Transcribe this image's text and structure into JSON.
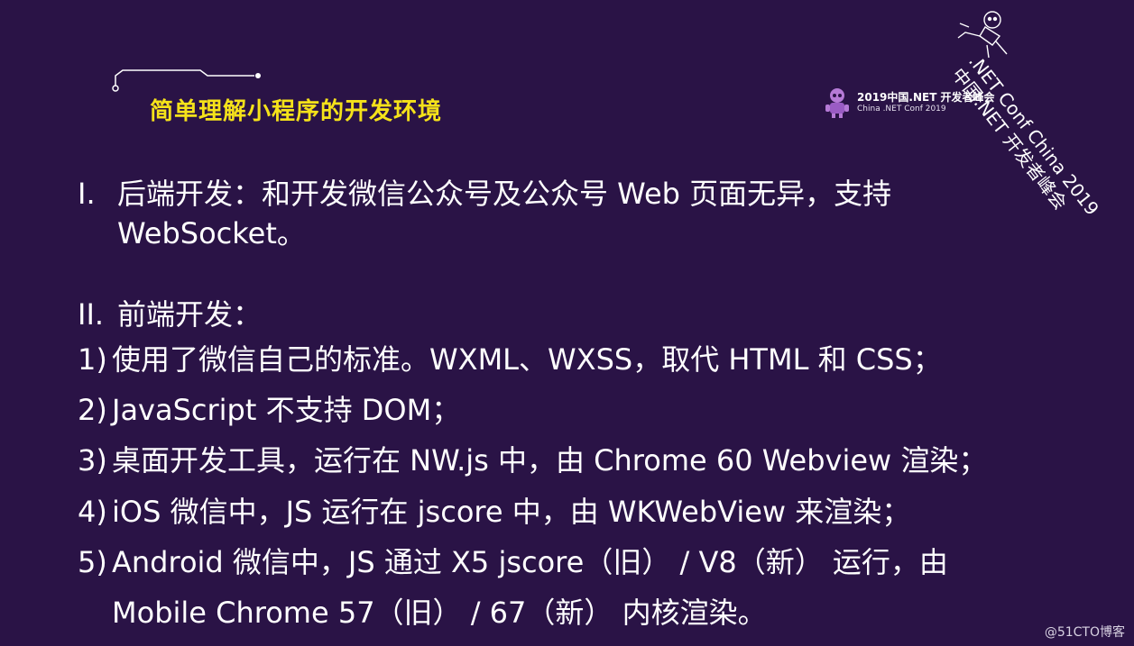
{
  "slide": {
    "heading": "简单理解小程序的开发环境",
    "logo": {
      "title": "2019中国.NET 开发者峰会",
      "subtitle": "China .NET Conf 2019"
    },
    "corner_banner": {
      "line1": ".NET Conf China 2019",
      "line2": "中国.NET 开发者峰会"
    },
    "items": [
      {
        "marker": "I.",
        "lines": [
          "后端开发：和开发微信公众号及公众号 Web 页面无异，支持",
          "WebSocket。"
        ]
      },
      {
        "marker": "II.",
        "lines": [
          "前端开发："
        ]
      }
    ],
    "sub_items": [
      {
        "marker": "1)",
        "lines": [
          "使用了微信自己的标准。WXML、WXSS，取代 HTML 和 CSS；"
        ]
      },
      {
        "marker": "2)",
        "lines": [
          "JavaScript 不支持 DOM；"
        ]
      },
      {
        "marker": "3)",
        "lines": [
          "桌面开发工具，运行在 NW.js 中，由 Chrome 60 Webview 渲染；"
        ]
      },
      {
        "marker": "4)",
        "lines": [
          "iOS 微信中，JS 运行在 jscore 中，由 WKWebView 来渲染；"
        ]
      },
      {
        "marker": "5)",
        "lines": [
          "Android 微信中，JS 通过 X5 jscore（旧） / V8（新） 运行，由",
          "Mobile Chrome 57（旧） / 67（新） 内核渲染。"
        ]
      }
    ],
    "watermark": "@51CTO博客",
    "colors": {
      "background": "#2a1346",
      "heading": "#f5e21a",
      "text": "#ffffff"
    }
  }
}
